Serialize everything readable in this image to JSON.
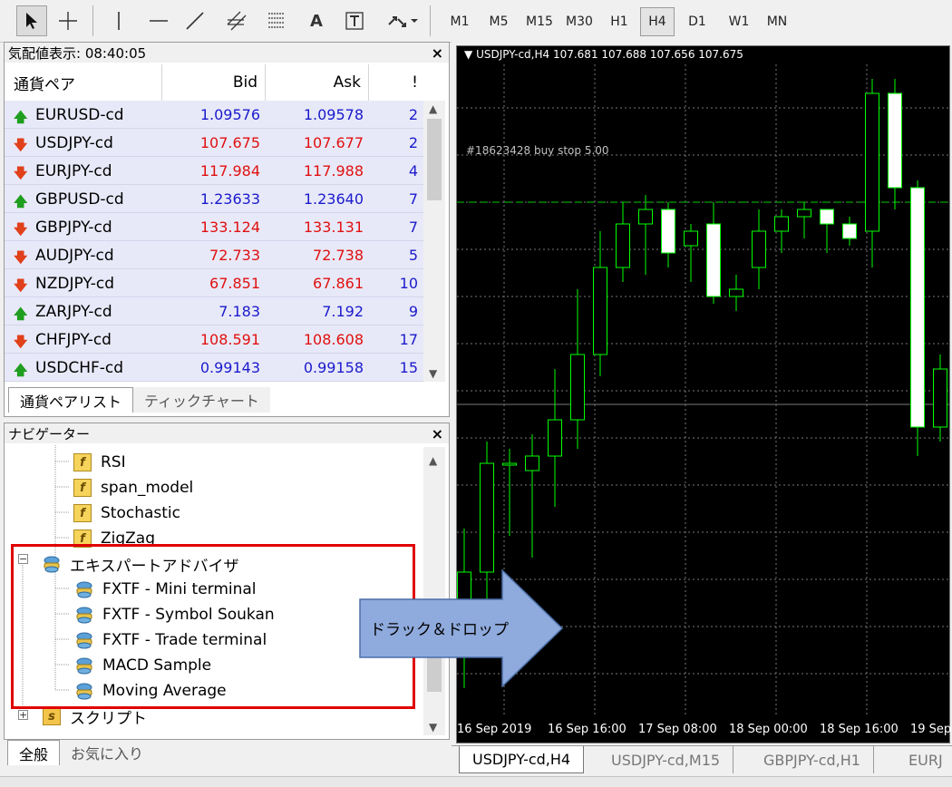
{
  "toolbar": {
    "tools": [
      "cursor-icon",
      "crosshair-icon",
      "vertical-line-icon",
      "horizontal-line-icon",
      "trendline-icon",
      "equidistant-channel-icon",
      "fibonacci-icon",
      "text-icon",
      "text-label-icon",
      "arrows-icon"
    ],
    "text_tool_label": "A",
    "timeframes": [
      "M1",
      "M5",
      "M15",
      "M30",
      "H1",
      "H4",
      "D1",
      "W1",
      "MN"
    ],
    "active_timeframe": "H4"
  },
  "market_watch": {
    "title": "気配値表示: 08:40:05",
    "columns": {
      "symbol": "通貨ペア",
      "bid": "Bid",
      "ask": "Ask",
      "spread": "!"
    },
    "rows": [
      {
        "symbol": "EURUSD-cd",
        "bid": "1.09576",
        "ask": "1.09578",
        "spread": "2",
        "dir": "up"
      },
      {
        "symbol": "USDJPY-cd",
        "bid": "107.675",
        "ask": "107.677",
        "spread": "2",
        "dir": "down"
      },
      {
        "symbol": "EURJPY-cd",
        "bid": "117.984",
        "ask": "117.988",
        "spread": "4",
        "dir": "down"
      },
      {
        "symbol": "GBPUSD-cd",
        "bid": "1.23633",
        "ask": "1.23640",
        "spread": "7",
        "dir": "up"
      },
      {
        "symbol": "GBPJPY-cd",
        "bid": "133.124",
        "ask": "133.131",
        "spread": "7",
        "dir": "down"
      },
      {
        "symbol": "AUDJPY-cd",
        "bid": "72.733",
        "ask": "72.738",
        "spread": "5",
        "dir": "down"
      },
      {
        "symbol": "NZDJPY-cd",
        "bid": "67.851",
        "ask": "67.861",
        "spread": "10",
        "dir": "down"
      },
      {
        "symbol": "ZARJPY-cd",
        "bid": "7.183",
        "ask": "7.192",
        "spread": "9",
        "dir": "up"
      },
      {
        "symbol": "CHFJPY-cd",
        "bid": "108.591",
        "ask": "108.608",
        "spread": "17",
        "dir": "down"
      },
      {
        "symbol": "USDCHF-cd",
        "bid": "0.99143",
        "ask": "0.99158",
        "spread": "15",
        "dir": "up"
      }
    ],
    "tabs": [
      "通貨ペアリスト",
      "ティックチャート"
    ],
    "active_tab": 0
  },
  "navigator": {
    "title": "ナビゲーター",
    "indicators": [
      "RSI",
      "span_model",
      "Stochastic",
      "ZigZag"
    ],
    "ea_group": "エキスパートアドバイザ",
    "ea_group_expander": "−",
    "experts": [
      "FXTF - Mini terminal",
      "FXTF - Symbol Soukan",
      "FXTF - Trade terminal",
      "MACD Sample",
      "Moving Average"
    ],
    "scripts_group": "スクリプト",
    "scripts_group_expander": "+",
    "tabs": [
      "全般",
      "お気に入り"
    ],
    "active_tab": 0
  },
  "chart": {
    "header": "USDJPY-cd,H4  107.681 107.688 107.656 107.675",
    "order_label": "#18623428 buy stop 5.00",
    "time_labels": [
      "16 Sep 2019",
      "16 Sep 16:00",
      "17 Sep 08:00",
      "18 Sep 00:00",
      "18 Sep 16:00",
      "19 Sep"
    ],
    "tabs": [
      "USDJPY-cd,H4",
      "USDJPY-cd,M15",
      "GBPJPY-cd,H1",
      "EURJ"
    ],
    "active_tab": 0,
    "colors": {
      "background": "#000000",
      "bull": "#00ff00",
      "bear_fill": "#ffffff",
      "order_line": "#00cc00",
      "grid": "#777777"
    }
  },
  "chart_data": {
    "type": "candlestick",
    "symbol": "USDJPY-cd",
    "timeframe": "H4",
    "candles": [
      {
        "o": 107.66,
        "h": 107.81,
        "l": 107.59,
        "c": 107.75
      },
      {
        "o": 107.75,
        "h": 107.93,
        "l": 107.71,
        "c": 107.9
      },
      {
        "o": 107.9,
        "h": 107.92,
        "l": 107.8,
        "c": 107.9
      },
      {
        "o": 107.89,
        "h": 107.94,
        "l": 107.77,
        "c": 107.91
      },
      {
        "o": 107.91,
        "h": 108.03,
        "l": 107.84,
        "c": 107.96
      },
      {
        "o": 107.96,
        "h": 108.14,
        "l": 107.92,
        "c": 108.05
      },
      {
        "o": 108.05,
        "h": 108.22,
        "l": 108.02,
        "c": 108.17
      },
      {
        "o": 108.17,
        "h": 108.26,
        "l": 108.15,
        "c": 108.23
      },
      {
        "o": 108.23,
        "h": 108.27,
        "l": 108.16,
        "c": 108.25
      },
      {
        "o": 108.25,
        "h": 108.26,
        "l": 108.17,
        "c": 108.19
      },
      {
        "o": 108.2,
        "h": 108.23,
        "l": 108.15,
        "c": 108.22
      },
      {
        "o": 108.23,
        "h": 108.26,
        "l": 108.12,
        "c": 108.13
      },
      {
        "o": 108.13,
        "h": 108.16,
        "l": 108.11,
        "c": 108.14
      },
      {
        "o": 108.17,
        "h": 108.25,
        "l": 108.14,
        "c": 108.22
      },
      {
        "o": 108.22,
        "h": 108.25,
        "l": 108.19,
        "c": 108.24
      },
      {
        "o": 108.24,
        "h": 108.26,
        "l": 108.21,
        "c": 108.25
      },
      {
        "o": 108.25,
        "h": 108.25,
        "l": 108.19,
        "c": 108.23
      },
      {
        "o": 108.23,
        "h": 108.24,
        "l": 108.2,
        "c": 108.21
      },
      {
        "o": 108.22,
        "h": 108.43,
        "l": 108.17,
        "c": 108.41
      },
      {
        "o": 108.41,
        "h": 108.43,
        "l": 108.25,
        "c": 108.28
      },
      {
        "o": 108.28,
        "h": 108.29,
        "l": 107.91,
        "c": 107.95
      },
      {
        "o": 107.95,
        "h": 108.05,
        "l": 107.93,
        "c": 108.03
      },
      {
        "o": 108.03,
        "h": 108.04,
        "l": 107.96,
        "c": 108.0
      }
    ],
    "order_price": 108.26,
    "ylim": [
      107.55,
      108.45
    ]
  },
  "annotation": {
    "drag_drop_label": "ドラック＆ドロップ",
    "colors": {
      "highlight_border": "#e00000",
      "arrow_fill": "#8faadc",
      "arrow_stroke": "#4a6ea8"
    }
  }
}
